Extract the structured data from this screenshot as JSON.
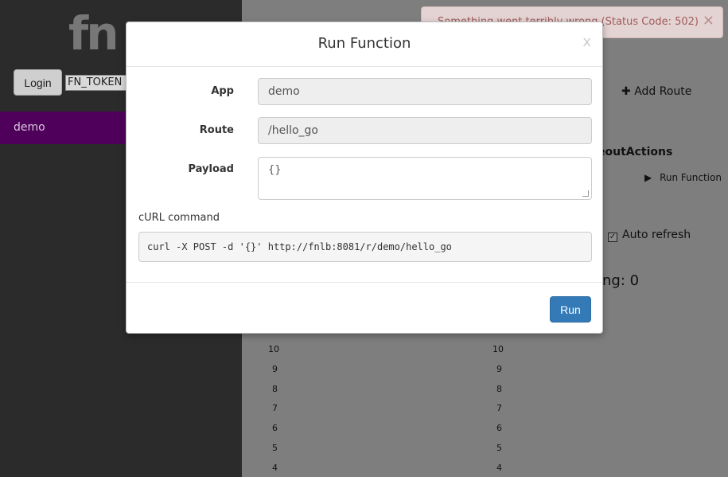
{
  "sidebar": {
    "logo": "fn",
    "login_label": "Login",
    "token_value": "FN_TOKEN",
    "apps": [
      "demo"
    ]
  },
  "main": {
    "add_route_label": "Add Route",
    "route_fragment": "eoutActions",
    "run_function_label": "Run Function",
    "auto_refresh_label": "Auto refresh",
    "waiting_fragment": "ng: 0",
    "axis_labels": [
      "10",
      "9",
      "8",
      "7",
      "6",
      "5",
      "4"
    ]
  },
  "toast": {
    "message": "Something went terribly wrong (Status Code: 502)",
    "close": "×"
  },
  "modal": {
    "title": "Run Function",
    "close": "x",
    "app_label": "App",
    "app_value": "demo",
    "route_label": "Route",
    "route_value": "/hello_go",
    "payload_label": "Payload",
    "payload_value": "{}",
    "curl_label": "cURL command",
    "curl_command": "curl -X POST -d '{}' http://fnlb:8081/r/demo/hello_go",
    "run_label": "Run"
  },
  "colors": {
    "primary_button": "#337ab7",
    "sidebar_selected": "#4f005a",
    "toast_text": "#a05b5b"
  }
}
